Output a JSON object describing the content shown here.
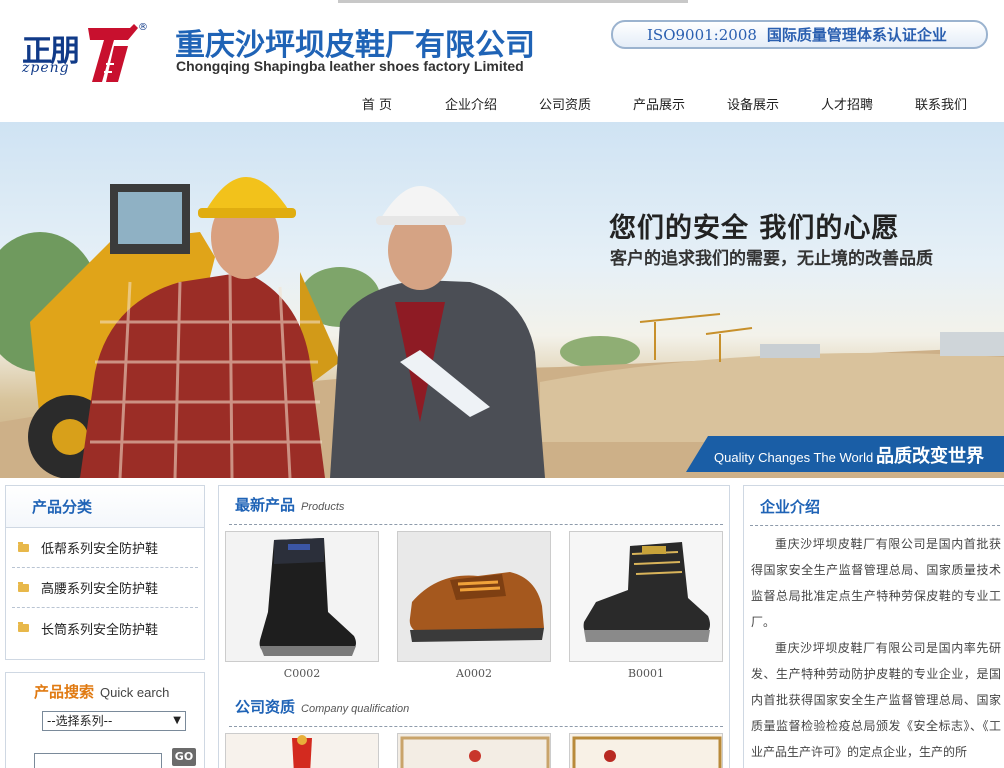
{
  "header": {
    "logo_cn": "正朋",
    "logo_en": "zpeng",
    "logo_reg": "®",
    "company_cn": "重庆沙坪坝皮鞋厂有限公司",
    "company_en": "Chongqing Shapingba leather shoes factory Limited",
    "iso_code": "ISO9001:2008",
    "iso_text": "国际质量管理体系认证企业"
  },
  "nav": [
    "首 页",
    "企业介绍",
    "公司资质",
    "产品展示",
    "设备展示",
    "人才招聘",
    "联系我们"
  ],
  "banner": {
    "headline": "您们的安全   我们的心愿",
    "subline": "客户的追求我们的需要，无止境的改善品质",
    "slogan_en": "Quality Changes The World",
    "slogan_cn": "品质改变世界",
    "colors": {
      "strip": "#1a5ea6",
      "helmet_yellow": "#f2c21b",
      "helmet_white": "#f4f4f4"
    }
  },
  "categories": {
    "title": "产品分类",
    "items": [
      "低帮系列安全防护鞋",
      "高腰系列安全防护鞋",
      "长筒系列安全防护鞋"
    ]
  },
  "search": {
    "title_cn": "产品搜索",
    "title_en": "Quick earch",
    "select_value": "--选择系列--",
    "input_value": "",
    "button": "GO"
  },
  "products": {
    "title_cn": "最新产品",
    "title_en": "Products",
    "items": [
      {
        "code": "C0002",
        "icon": "tall-boot-icon"
      },
      {
        "code": "A0002",
        "icon": "low-shoe-icon"
      },
      {
        "code": "B0001",
        "icon": "high-boot-icon"
      }
    ]
  },
  "qualification": {
    "title_cn": "公司资质",
    "title_en": "Company qualification"
  },
  "intro": {
    "title": "企业介绍",
    "paragraphs": [
      "重庆沙坪坝皮鞋厂有限公司是国内首批获得国家安全生产监督管理总局、国家质量技术监督总局批准定点生产特种劳保皮鞋的专业工厂。",
      "重庆沙坪坝皮鞋厂有限公司是国内率先研发、生产特种劳动防护皮鞋的专业企业，是国内首批获得国家安全生产监督管理总局、国家质量监督检验检疫总局颁发《安全标志》、《工业产品生产许可》的定点企业，生产的所"
    ]
  },
  "colors": {
    "brand_blue": "#1f63b6",
    "search_orange": "#e07a12"
  }
}
